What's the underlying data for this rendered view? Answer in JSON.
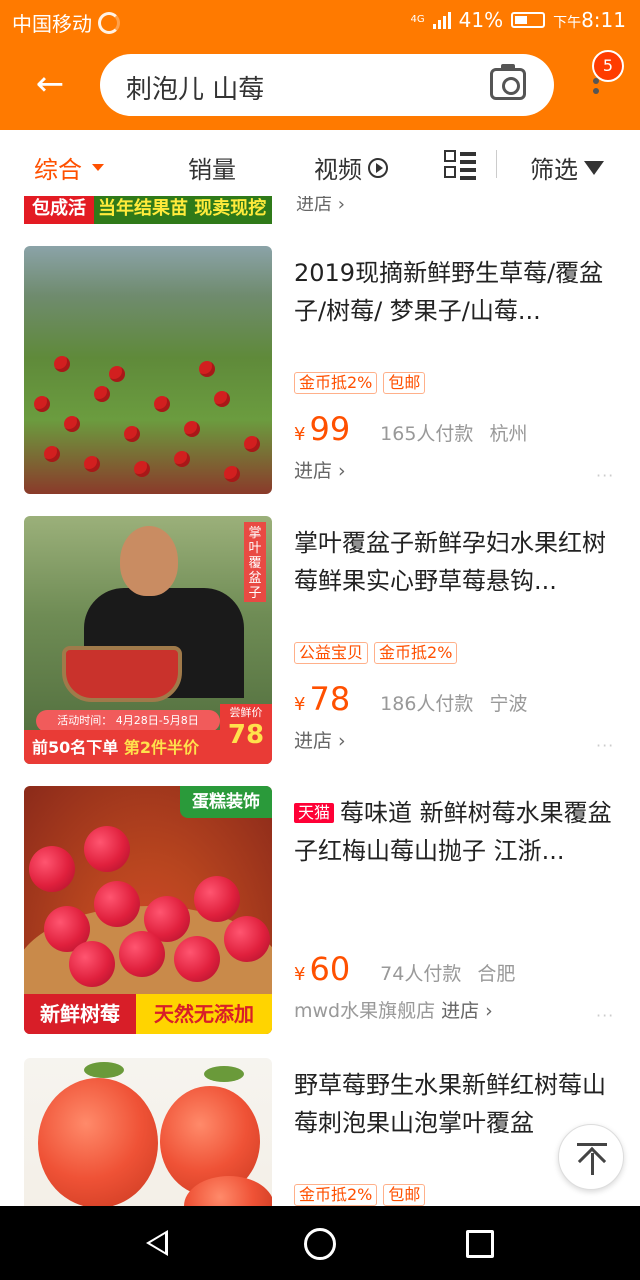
{
  "status_bar": {
    "carrier": "中国移动",
    "network": "4G",
    "battery": "41%",
    "time_prefix": "下午",
    "time": "8:11"
  },
  "search": {
    "query": "刺泡儿 山莓",
    "notification_count": "5"
  },
  "tabs": {
    "comprehensive": "综合",
    "sales": "销量",
    "video": "视频",
    "filter": "筛选"
  },
  "partial_item": {
    "banner_left": "包成活",
    "banner_right": "当年结果苗 现卖现挖",
    "shop_link": "进店 ›"
  },
  "products": [
    {
      "title": "2019现摘新鲜野生草莓/覆盆子/树莓/ 梦果子/山莓...",
      "tags": [
        "金币抵2%",
        "包邮"
      ],
      "price": "99",
      "sold": "165人付款",
      "location": "杭州",
      "shop_name": "",
      "shop_link": "进店 ›"
    },
    {
      "title": "掌叶覆盆子新鲜孕妇水果红树莓鲜果实心野草莓悬钩...",
      "tags": [
        "公益宝贝",
        "金币抵2%"
      ],
      "price": "78",
      "sold": "186人付款",
      "location": "宁波",
      "shop_name": "",
      "shop_link": "进店 ›",
      "thumb_side": "掌叶覆盆子",
      "thumb_activity": "活动时间：  4月28日-5月8日",
      "thumb_bottom_a": "前50名下单",
      "thumb_bottom_b": "第2件半价",
      "thumb_price_label": "尝鲜价",
      "thumb_price": "78"
    },
    {
      "tmall": "天猫",
      "title": "莓味道 新鲜树莓水果覆盆子红梅山莓山抛子 江浙...",
      "tags": [],
      "price": "60",
      "sold": "74人付款",
      "location": "合肥",
      "shop_name": "mwd水果旗舰店",
      "shop_link": "进店 ›",
      "thumb_top": "蛋糕装饰",
      "thumb_bottom_a": "新鲜树莓",
      "thumb_bottom_b": "天然无添加"
    },
    {
      "title": "野草莓野生水果新鲜红树莓山莓刺泡果山泡掌叶覆盆",
      "tags": [
        "金币抵2%",
        "包邮"
      ]
    }
  ],
  "currency_symbol": "¥",
  "more_dots": "···",
  "colors": {
    "brand_orange": "#ff7a00",
    "price_orange": "#ff5000",
    "tmall_red": "#ff0036"
  },
  "icons": {
    "back": "left-arrow",
    "camera": "camera",
    "more": "vertical-dots",
    "video": "play-circle",
    "layout": "grid-list",
    "filter": "funnel",
    "to_top": "arrow-up",
    "nav": [
      "triangle-back",
      "circle-home",
      "square-recents"
    ]
  }
}
